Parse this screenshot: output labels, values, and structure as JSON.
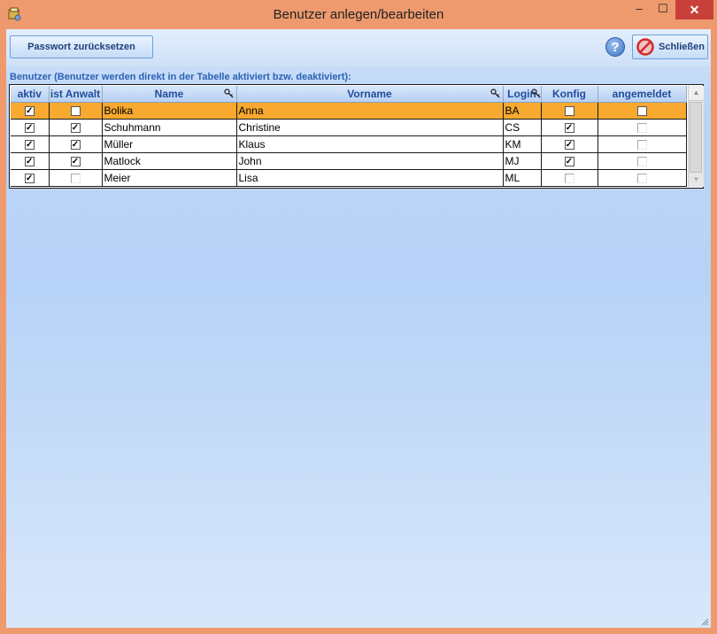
{
  "window": {
    "title": "Benutzer anlegen/bearbeiten",
    "minimize_glyph": "–",
    "maximize_glyph": "☐",
    "close_glyph": "✕"
  },
  "toolbar": {
    "reset_password_label": "Passwort zurücksetzen",
    "help_glyph": "?",
    "close_label": "Schließen"
  },
  "section_label": "Benutzer (Benutzer werden direkt in der Tabelle aktiviert bzw. deaktiviert):",
  "table": {
    "columns": {
      "aktiv": "aktiv",
      "anwalt": "ist Anwalt",
      "name": "Name",
      "vorname": "Vorname",
      "login": "Login",
      "konfig": "Konfig",
      "angemeldet": "angemeldet"
    },
    "rows": [
      {
        "aktiv": true,
        "anwalt": false,
        "name": "Bolika",
        "vorname": "Anna",
        "login": "BA",
        "konfig": false,
        "angemeldet": false
      },
      {
        "aktiv": true,
        "anwalt": true,
        "name": "Schuhmann",
        "vorname": "Christine",
        "login": "CS",
        "konfig": true,
        "angemeldet": false
      },
      {
        "aktiv": true,
        "anwalt": true,
        "name": "Müller",
        "vorname": "Klaus",
        "login": "KM",
        "konfig": true,
        "angemeldet": false
      },
      {
        "aktiv": true,
        "anwalt": true,
        "name": "Matlock",
        "vorname": "John",
        "login": "MJ",
        "konfig": true,
        "angemeldet": false
      },
      {
        "aktiv": true,
        "anwalt": false,
        "name": "Meier",
        "vorname": "Lisa",
        "login": "ML",
        "konfig": false,
        "angemeldet": false
      }
    ],
    "selected_row": 0
  },
  "colors": {
    "titlebar": "#ee9a6e",
    "close_button": "#c7413a",
    "selected_row": "#f8a92f",
    "header_text": "#1f4e9c"
  },
  "icons": {
    "app": "app-icon",
    "help": "help-icon",
    "close_app": "no-entry-icon",
    "sort_key": "key-icon"
  }
}
